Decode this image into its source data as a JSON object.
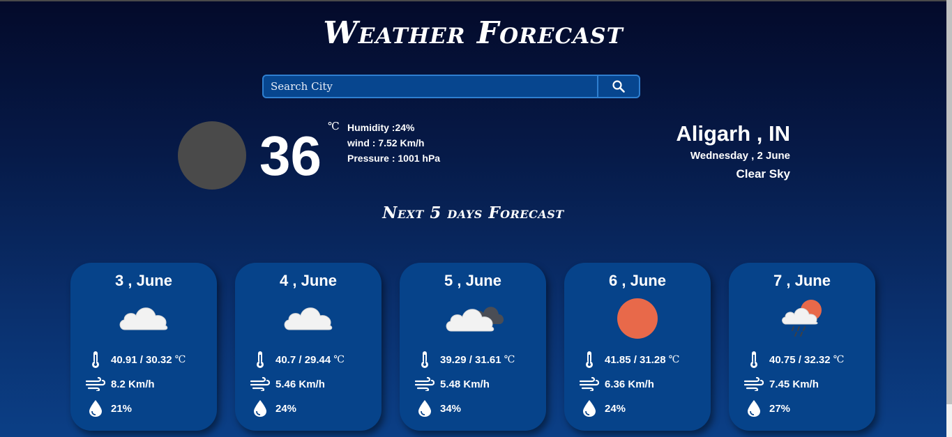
{
  "app": {
    "title": "Weather Forecast"
  },
  "search": {
    "placeholder": "Search City",
    "value": ""
  },
  "current": {
    "temperature": "36",
    "unit": "℃",
    "humidity": "Humidity :24%",
    "wind": "wind : 7.52 Km/h",
    "pressure": "Pressure : 1001 hPa",
    "city": "Aligarh , IN",
    "date": "Wednesday , 2 June",
    "condition": "Clear Sky",
    "icon": "placeholder-circle-icon"
  },
  "forecast": {
    "title": "Next 5 days Forecast",
    "unit": "℃",
    "days": [
      {
        "date": "3 , June",
        "temp": "40.91 / 30.32",
        "wind": "8.2 Km/h",
        "humidity": "21%",
        "icon": "cloud-icon"
      },
      {
        "date": "4 , June",
        "temp": "40.7 / 29.44",
        "wind": "5.46 Km/h",
        "humidity": "24%",
        "icon": "cloud-icon"
      },
      {
        "date": "5 , June",
        "temp": "39.29 / 31.61",
        "wind": "5.48 Km/h",
        "humidity": "34%",
        "icon": "cloudy-dark-cloud-icon"
      },
      {
        "date": "6 , June",
        "temp": "41.85 / 31.28",
        "wind": "6.36 Km/h",
        "humidity": "24%",
        "icon": "sun-icon"
      },
      {
        "date": "7 , June",
        "temp": "40.75 / 32.32",
        "wind": "7.45 Km/h",
        "humidity": "27%",
        "icon": "rain-sun-cloud-icon"
      }
    ]
  },
  "colors": {
    "sun": "#e8694a",
    "cloud": "#f2f2f2",
    "dark_cloud": "#4a4d55",
    "card": "#06438a"
  }
}
